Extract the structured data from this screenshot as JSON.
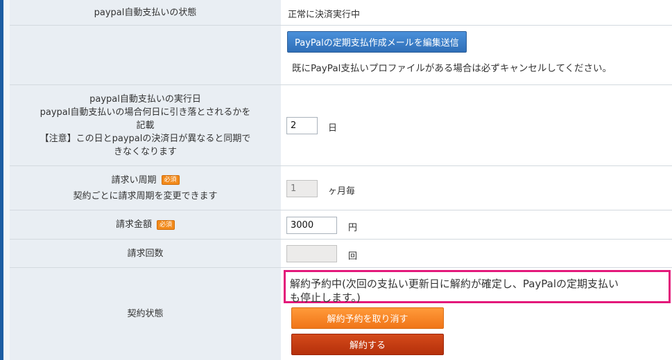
{
  "rows": {
    "payment_status": {
      "label": "paypal自動支払いの状態",
      "value": "正常に決済実行中"
    },
    "paypal_mail": {
      "button_label": "PayPalの定期支払作成メールを編集送信",
      "note": "既にPayPal支払いプロファイルがある場合は必ずキャンセルしてください。"
    },
    "execution_day": {
      "label_line1": "paypal自動支払いの実行日",
      "label_line2": "paypal自動支払いの場合何日に引き落とされるかを",
      "label_line3": "記載",
      "label_line4": "【注意】この日とpaypalの決済日が異なると同期で",
      "label_line5": "きなくなります",
      "input_value": "2",
      "unit": "日"
    },
    "billing_cycle": {
      "label": "請求い周期",
      "badge": "必須",
      "sub_label": "契約ごとに請求周期を変更できます",
      "input_value": "1",
      "unit": "ヶ月毎"
    },
    "billing_amount": {
      "label": "請求金額",
      "badge": "必須",
      "input_value": "3000",
      "unit": "円"
    },
    "billing_count": {
      "label": "請求回数",
      "input_value": "",
      "unit": "回"
    },
    "contract_status": {
      "label": "契約状態",
      "status_line1": "解約予約中(次回の支払い更新日に解約が確定し、PayPalの定期支払い",
      "status_line2": "も停止します。)",
      "cancel_reservation_button": "解約予約を取り消す",
      "cancel_button": "解約する"
    }
  },
  "colors": {
    "label_bg": "#e9eef3",
    "highlight_border": "#e3187a",
    "badge": "#f28a1b",
    "primary_button": "#2f6fb8",
    "orange_button": "#f07518",
    "red_button": "#b5300b"
  }
}
